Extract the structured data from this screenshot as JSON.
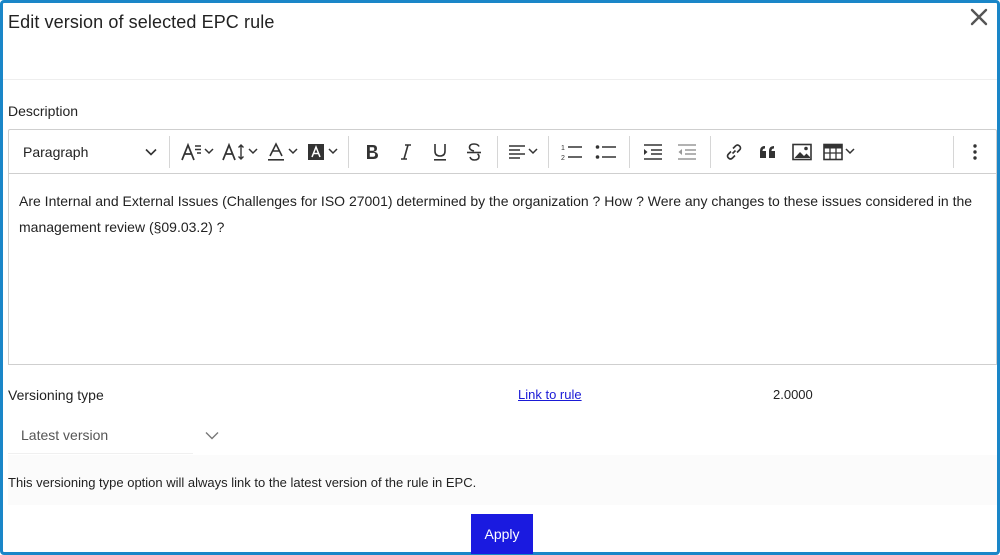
{
  "dialog": {
    "title": "Edit version of selected EPC rule",
    "close_icon": "close-icon"
  },
  "description": {
    "label": "Description"
  },
  "toolbar": {
    "paragraph_label": "Paragraph",
    "icons": [
      "font-size-icon",
      "line-height-icon",
      "font-color-icon",
      "background-color-icon",
      "bold-icon",
      "italic-icon",
      "underline-icon",
      "strikethrough-icon",
      "align-icon",
      "numbered-list-icon",
      "bulleted-list-icon",
      "indent-icon",
      "outdent-icon",
      "link-icon",
      "quote-icon",
      "image-icon",
      "table-icon",
      "more-icon"
    ]
  },
  "editor": {
    "content": "Are Internal and External Issues (Challenges for ISO 27001) determined by the organization ? How ? Were any changes to these issues considered in the management review (§09.03.2) ?"
  },
  "versioning": {
    "label": "Versioning type",
    "link_label": "Link to rule",
    "version": "2.0000",
    "selected": "Latest version",
    "info": "This versioning type option will always link to the latest version of the rule in EPC."
  },
  "actions": {
    "apply_label": "Apply"
  }
}
